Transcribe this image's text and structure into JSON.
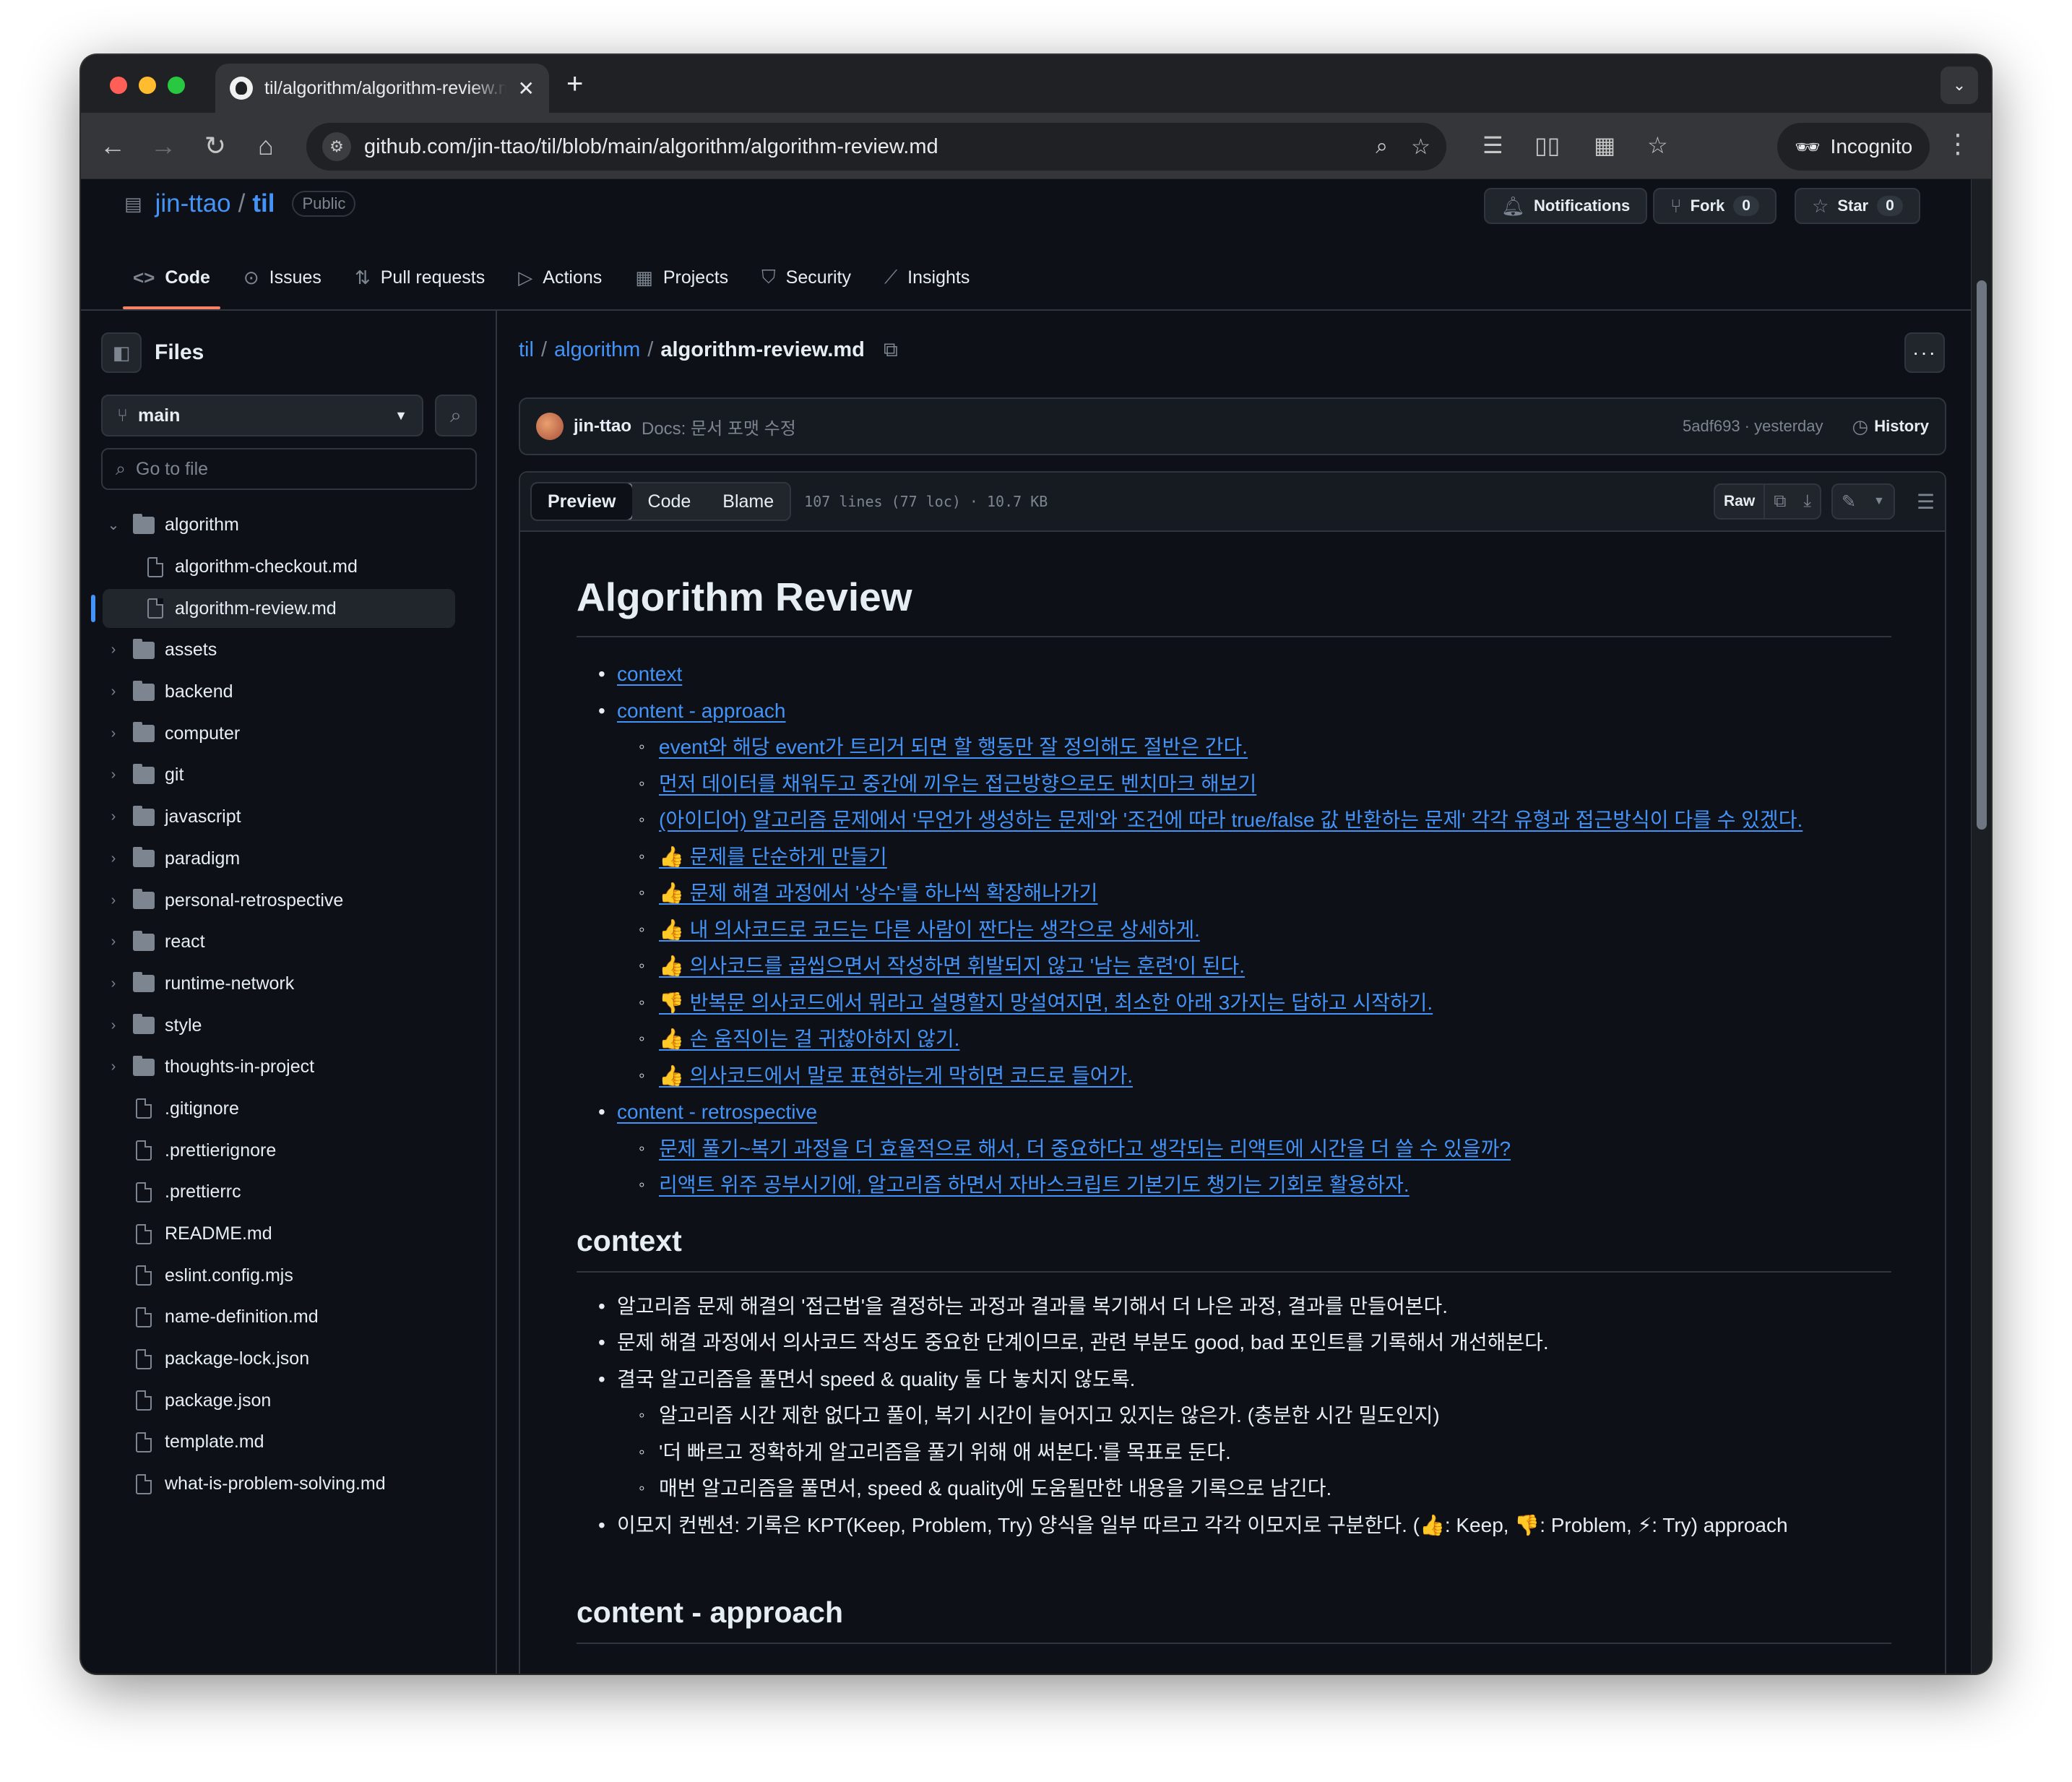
{
  "browser": {
    "tab_title": "til/algorithm/algorithm-review.md at main · jin-ttao/til",
    "url": "github.com/jin-ttao/til/blob/main/algorithm/algorithm-review.md",
    "incognito_label": "Incognito",
    "new_tab": "+",
    "close_tab": "✕"
  },
  "repo": {
    "owner": "jin-ttao",
    "sep": "/",
    "name": "til",
    "visibility": "Public",
    "notifications_label": "Notifications",
    "fork_label": "Fork",
    "fork_count": "0",
    "star_label": "Star",
    "star_count": "0"
  },
  "nav": [
    {
      "icon": "code-icon",
      "label": "Code",
      "active": true
    },
    {
      "icon": "issue-icon",
      "label": "Issues"
    },
    {
      "icon": "pull-request-icon",
      "label": "Pull requests"
    },
    {
      "icon": "actions-icon",
      "label": "Actions"
    },
    {
      "icon": "projects-icon",
      "label": "Projects"
    },
    {
      "icon": "security-icon",
      "label": "Security"
    },
    {
      "icon": "insights-icon",
      "label": "Insights"
    }
  ],
  "sidebar": {
    "title": "Files",
    "branch": "main",
    "goto_placeholder": "Go to file",
    "tree": [
      {
        "type": "folder",
        "name": "algorithm",
        "expanded": true,
        "level": 0
      },
      {
        "type": "file",
        "name": "algorithm-checkout.md",
        "level": 1
      },
      {
        "type": "file",
        "name": "algorithm-review.md",
        "level": 1,
        "selected": true
      },
      {
        "type": "folder",
        "name": "assets",
        "level": 0
      },
      {
        "type": "folder",
        "name": "backend",
        "level": 0
      },
      {
        "type": "folder",
        "name": "computer",
        "level": 0
      },
      {
        "type": "folder",
        "name": "git",
        "level": 0
      },
      {
        "type": "folder",
        "name": "javascript",
        "level": 0
      },
      {
        "type": "folder",
        "name": "paradigm",
        "level": 0
      },
      {
        "type": "folder",
        "name": "personal-retrospective",
        "level": 0
      },
      {
        "type": "folder",
        "name": "react",
        "level": 0
      },
      {
        "type": "folder",
        "name": "runtime-network",
        "level": 0
      },
      {
        "type": "folder",
        "name": "style",
        "level": 0
      },
      {
        "type": "folder",
        "name": "thoughts-in-project",
        "level": 0
      },
      {
        "type": "file",
        "name": ".gitignore",
        "level": 0
      },
      {
        "type": "file",
        "name": ".prettierignore",
        "level": 0
      },
      {
        "type": "file",
        "name": ".prettierrc",
        "level": 0
      },
      {
        "type": "file",
        "name": "README.md",
        "level": 0
      },
      {
        "type": "file",
        "name": "eslint.config.mjs",
        "level": 0
      },
      {
        "type": "file",
        "name": "name-definition.md",
        "level": 0
      },
      {
        "type": "file",
        "name": "package-lock.json",
        "level": 0
      },
      {
        "type": "file",
        "name": "package.json",
        "level": 0
      },
      {
        "type": "file",
        "name": "template.md",
        "level": 0
      },
      {
        "type": "file",
        "name": "what-is-problem-solving.md",
        "level": 0
      }
    ]
  },
  "breadcrumb": {
    "root": "til",
    "folder": "algorithm",
    "file": "algorithm-review.md",
    "sep": "/"
  },
  "commit": {
    "author": "jin-ttao",
    "message": "Docs: 문서 포맷 수정",
    "meta": "5adf693 · yesterday",
    "history_label": "History"
  },
  "file": {
    "tabs": [
      "Preview",
      "Code",
      "Blame"
    ],
    "info": "107 lines (77 loc) · 10.7 KB",
    "raw_label": "Raw"
  },
  "markdown": {
    "title": "Algorithm Review",
    "toc": [
      {
        "label": "context",
        "children": []
      },
      {
        "label": "content - approach",
        "children": [
          "event와 해당 event가 트리거 되면 할 행동만 잘 정의해도 절반은 간다.",
          "먼저 데이터를 채워두고 중간에 끼우는 접근방향으로도 벤치마크 해보기",
          "(아이디어) 알고리즘 문제에서 '무언가 생성하는 문제'와 '조건에 따라 true/false 값 반환하는 문제' 각각 유형과 접근방식이 다를 수 있겠다.",
          "👍 문제를 단순하게 만들기",
          "👍 문제 해결 과정에서 '상수'를 하나씩 확장해나가기",
          "👍 내 의사코드로 코드는 다른 사람이 짠다는 생각으로 상세하게.",
          "👍 의사코드를 곱씹으면서 작성하면 휘발되지 않고 '남는 훈련'이 된다.",
          "👎 반복문 의사코드에서 뭐라고 설명할지 망설여지면, 최소한 아래 3가지는 답하고 시작하기.",
          "👍 손 움직이는 걸 귀찮아하지 않기.",
          "👍 의사코드에서 말로 표현하는게 막히면 코드로 들어가."
        ]
      },
      {
        "label": "content - retrospective",
        "children": [
          "문제 풀기~복기 과정을 더 효율적으로 해서, 더 중요하다고 생각되는 리액트에 시간을 더 쓸 수 있을까?",
          "리액트 위주 공부시기에, 알고리즘 하면서 자바스크립트 기본기도 챙기는 기회로 활용하자."
        ]
      }
    ],
    "context_heading": "context",
    "context_items": [
      {
        "text": "알고리즘 문제 해결의 '접근법'을 결정하는 과정과 결과를 복기해서 더 나은 과정, 결과를 만들어본다.",
        "children": []
      },
      {
        "text": "문제 해결 과정에서 의사코드 작성도 중요한 단계이므로, 관련 부분도 good, bad 포인트를 기록해서 개선해본다.",
        "children": []
      },
      {
        "text": "결국 알고리즘을 풀면서 speed & quality 둘 다 놓치지 않도록.",
        "children": [
          "알고리즘 시간 제한 없다고 풀이, 복기 시간이 늘어지고 있지는 않은가. (충분한 시간 밀도인지)",
          "'더 빠르고 정확하게 알고리즘을 풀기 위해 애 써본다.'를 목표로 둔다.",
          "매번 알고리즘을 풀면서, speed & quality에 도움될만한 내용을 기록으로 남긴다."
        ]
      },
      {
        "text": "이모지 컨벤션: 기록은 KPT(Keep, Problem, Try) 양식을 일부 따르고 각각 이모지로 구분한다. (👍: Keep, 👎: Problem, ⚡: Try) approach",
        "children": []
      }
    ],
    "approach_heading": "content - approach"
  }
}
